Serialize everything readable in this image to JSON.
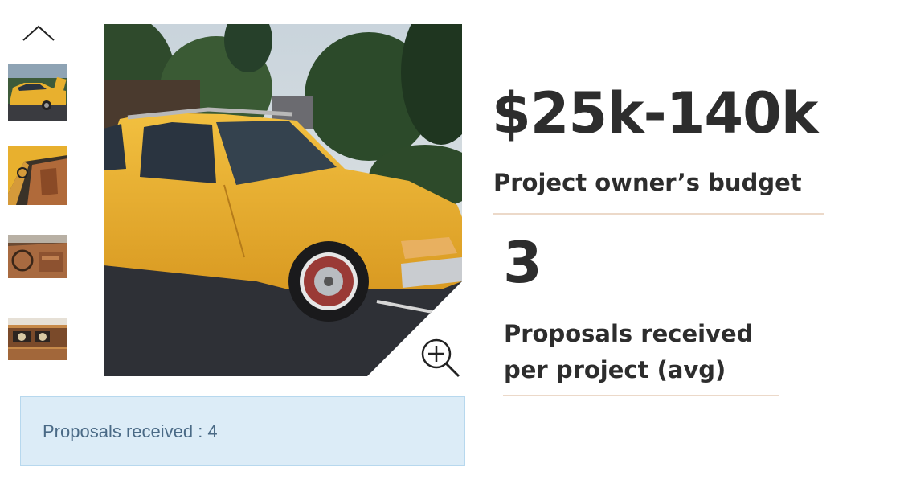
{
  "gallery": {
    "up_icon": "chevron-up-icon",
    "zoom_icon": "zoom-in-icon",
    "thumbnails": [
      {
        "name": "thumbnail-exterior"
      },
      {
        "name": "thumbnail-interior-door"
      },
      {
        "name": "thumbnail-interior-seats"
      },
      {
        "name": "thumbnail-dashboard"
      }
    ]
  },
  "proposals_bar": {
    "text": "Proposals received : 4"
  },
  "stats": {
    "budget_value": "$25k-140k",
    "budget_label": "Project owner’s budget",
    "proposals_value": "3",
    "proposals_label_line1": "Proposals received",
    "proposals_label_line2": "per project (avg)"
  },
  "colors": {
    "accent_divider": "#ecd9c9",
    "bar_background": "#dcecf7",
    "bar_text": "#4a6a86",
    "car_yellow": "#e8b02e",
    "stat_text": "#2d2d2d"
  }
}
